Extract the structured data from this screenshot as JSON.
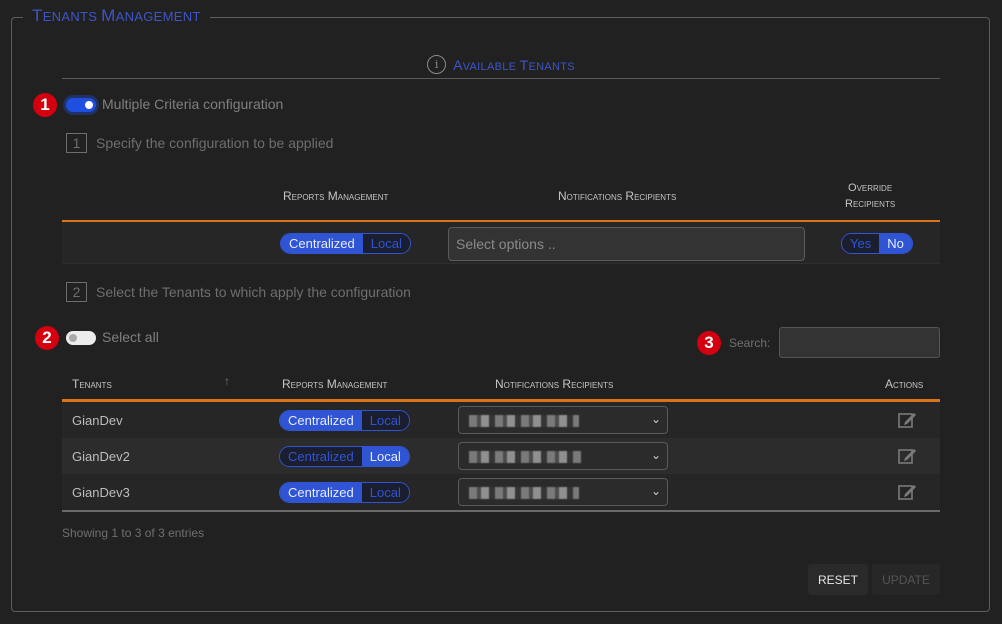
{
  "panel": {
    "title_first": "T",
    "title_rest": "enants ",
    "title_second": "M",
    "title_second_rest": "anagement"
  },
  "available": {
    "title_a": "A",
    "title_a_rest": "vailable ",
    "title_b": "T",
    "title_b_rest": "enants",
    "icon": "info-icon"
  },
  "badges": [
    "1",
    "2",
    "3"
  ],
  "multiple_criteria": {
    "label": "Multiple Criteria configuration",
    "enabled": true
  },
  "step1": {
    "num": "1",
    "label": "Specify the configuration to be applied"
  },
  "step2": {
    "num": "2",
    "label": "Select the Tenants to which apply the configuration"
  },
  "config_table": {
    "headers": {
      "reports": "Reports Management",
      "notifications": "Notifications Recipients",
      "override_line1": "Override",
      "override_line2": "Recipients"
    },
    "row": {
      "reports_options": [
        "Centralized",
        "Local"
      ],
      "reports_selected": "Centralized",
      "notifications_placeholder": "Select options ..",
      "override_options": [
        "Yes",
        "No"
      ],
      "override_selected": "No"
    }
  },
  "select_all": {
    "label": "Select all",
    "enabled": false
  },
  "search": {
    "label": "Search:",
    "value": ""
  },
  "tenants_table": {
    "headers": {
      "tenants": "Tenants",
      "reports": "Reports Management",
      "notifications": "Notifications Recipients",
      "actions": "Actions"
    },
    "rows": [
      {
        "tenant": "GianDev",
        "reports_selected": "Centralized",
        "recipients": "(blurred)"
      },
      {
        "tenant": "GianDev2",
        "reports_selected": "Local",
        "recipients": "(blurred)"
      },
      {
        "tenant": "GianDev3",
        "reports_selected": "Centralized",
        "recipients": "(blurred)"
      }
    ],
    "options": [
      "Centralized",
      "Local"
    ]
  },
  "footer": {
    "showing": "Showing 1 to 3 of 3 entries"
  },
  "buttons": {
    "reset": "RESET",
    "update": "UPDATE"
  },
  "colors": {
    "accent_blue": "#2f55d4",
    "header_orange": "#d9741a",
    "badge_red": "#d4000f"
  }
}
